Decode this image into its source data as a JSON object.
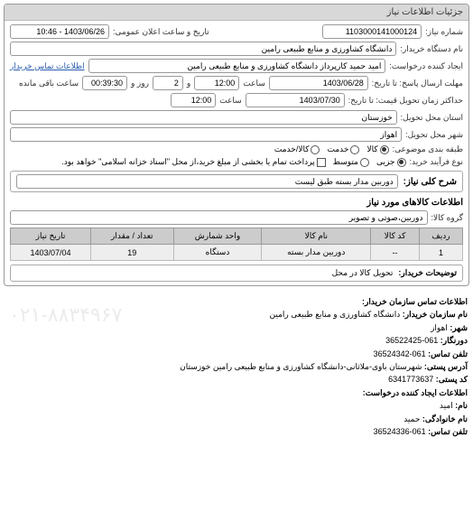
{
  "panel": {
    "title": "جزئیات اطلاعات نیاز"
  },
  "fields": {
    "request_no_label": "شماره نیاز:",
    "request_no": "1103000141000124",
    "announce_label": "تاریخ و ساعت اعلان عمومی:",
    "announce_value": "1403/06/26 - 10:46",
    "buyer_org_label": "نام دستگاه خریدار:",
    "buyer_org": "دانشگاه کشاورزی و منابع طبیعی رامین",
    "creator_label": "ایجاد کننده درخواست:",
    "creator": "امید حمید کارپرداز دانشگاه کشاورزی و منابع طبیعی رامین",
    "contact_link": "اطلاعات تماس خریدار",
    "deadline_label": "مهلت ارسال پاسخ: تا تاریخ:",
    "deadline_date": "1403/06/28",
    "saat": "ساعت",
    "deadline_time": "12:00",
    "va": "و",
    "remain_days": "2",
    "rooz_va": "روز و",
    "remain_time": "00:39:30",
    "remain_label": "ساعت باقی مانده",
    "price_label": "حداکثر زمان تحویل قیمت: تا تاریخ:",
    "price_date": "1403/07/30",
    "price_time": "12:00",
    "province_label": "استان محل تحویل:",
    "province": "خوزستان",
    "city_label": "شهر محل تحویل:",
    "city": "اهواز",
    "category_label": "طبقه بندی موضوعی:",
    "cat_kala": "کالا",
    "cat_khadamat": "خدمت",
    "cat_both": "کالا/خدمت",
    "process_label": "نوع فرآیند خرید:",
    "proc_jozi": "جزیی",
    "proc_motavaset": "متوسط",
    "proc_note": "پرداخت تمام یا بخشی از مبلغ خرید،از محل \"اسناد خزانه اسلامی\" خواهد بود."
  },
  "need": {
    "label": "شرح کلی نیاز:",
    "value": "دوربین مدار بسته طبق لیست"
  },
  "goods": {
    "title": "اطلاعات کالاهای مورد نیاز",
    "group_label": "گروه کالا:",
    "group_value": "دوربین،صوتی و تصویر",
    "headers": [
      "ردیف",
      "کد کالا",
      "نام کالا",
      "واحد شمارش",
      "تعداد / مقدار",
      "تاریخ نیاز"
    ],
    "row": {
      "idx": "1",
      "code": "--",
      "name": "دوربین مدار بسته",
      "unit": "دستگاه",
      "qty": "19",
      "date": "1403/07/04"
    }
  },
  "buyer_note": {
    "label": "توضیحات خریدار:",
    "value": "تحویل کالا در محل"
  },
  "contact": {
    "title": "اطلاعات تماس سازمان خریدار:",
    "org_label": "نام سازمان خریدار:",
    "org": "دانشگاه کشاورزی و منابع طبیعی رامین",
    "city_label": "شهر:",
    "city": "اهواز",
    "fax_label": "دورنگار:",
    "fax": "061-36522425",
    "phone_label": "تلفن تماس:",
    "phone": "061-36524342",
    "address_label": "آدرس پستی:",
    "address": "شهرستان باوی-ملاثانی-دانشگاه کشاورزی و منابع طبیعی رامین خوزستان",
    "postal_label": "کد پستی:",
    "postal": "6341773637",
    "creator_title": "اطلاعات ایجاد کننده درخواست:",
    "fname_label": "نام:",
    "fname": "امید",
    "lname_label": "نام خانوادگی:",
    "lname": "حمید",
    "cphone_label": "تلفن تماس:",
    "cphone": "061-36524336",
    "watermark": "۰۲۱-۸۸۳۴۹۶۷"
  }
}
